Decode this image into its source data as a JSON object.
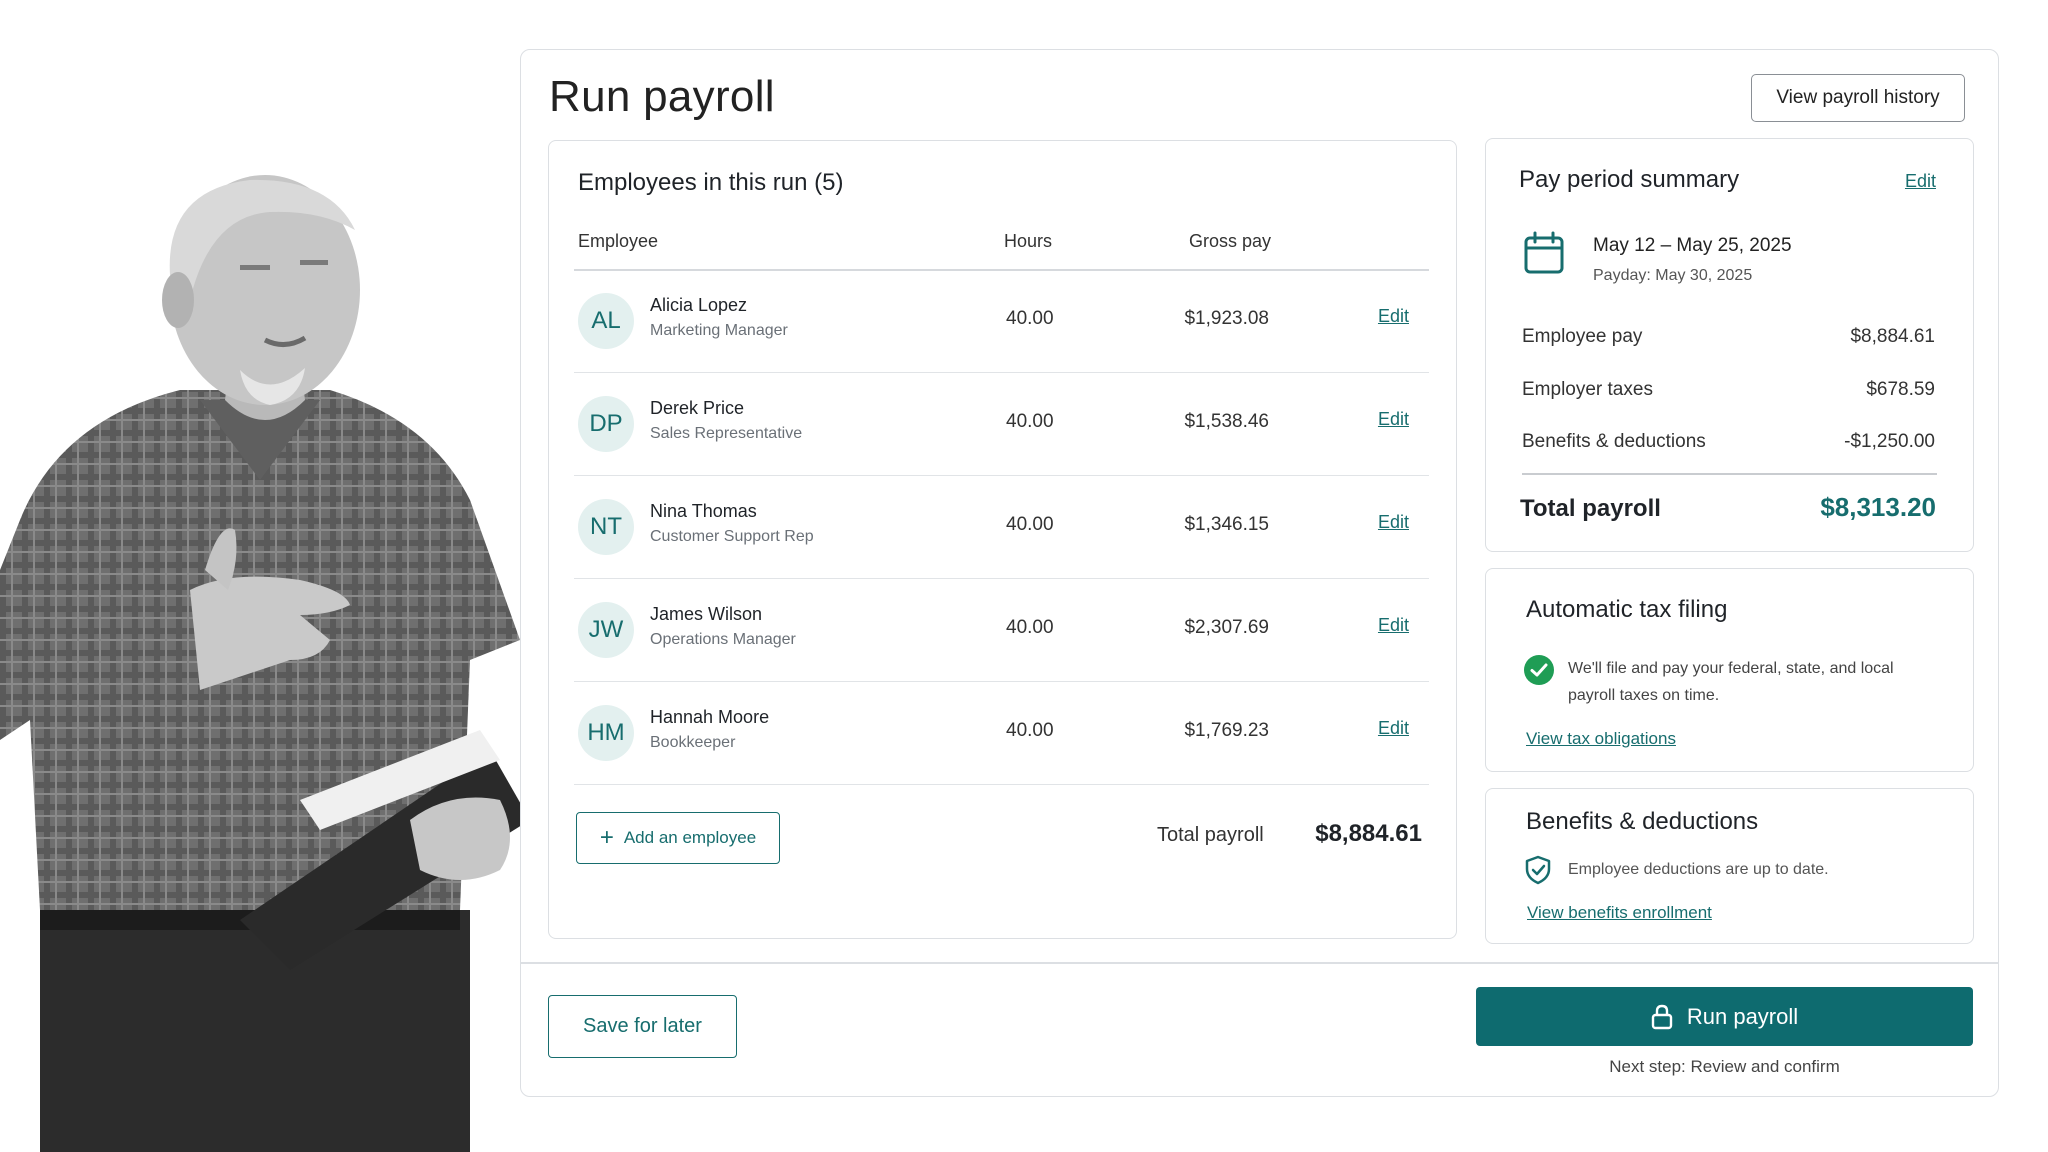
{
  "page": {
    "title": "Run payroll",
    "history_button": "View payroll history"
  },
  "employees_panel": {
    "title": "Employees in this run (5)",
    "columns": {
      "employee": "Employee",
      "hours": "Hours",
      "gross": "Gross pay"
    },
    "edit_label": "Edit",
    "rows": [
      {
        "initials": "AL",
        "name": "Alicia Lopez",
        "role": "Marketing Manager",
        "hours": "40.00",
        "gross": "$1,923.08"
      },
      {
        "initials": "DP",
        "name": "Derek Price",
        "role": "Sales Representative",
        "hours": "40.00",
        "gross": "$1,538.46"
      },
      {
        "initials": "NT",
        "name": "Nina Thomas",
        "role": "Customer Support Rep",
        "hours": "40.00",
        "gross": "$1,346.15"
      },
      {
        "initials": "JW",
        "name": "James Wilson",
        "role": "Operations Manager",
        "hours": "40.00",
        "gross": "$2,307.69"
      },
      {
        "initials": "HM",
        "name": "Hannah Moore",
        "role": "Bookkeeper",
        "hours": "40.00",
        "gross": "$1,769.23"
      }
    ],
    "add_button": "Add an employee",
    "total_label": "Total payroll",
    "total_value": "$8,884.61"
  },
  "summary": {
    "title": "Pay period summary",
    "edit_label": "Edit",
    "period_range": "May 12 – May 25, 2025",
    "payday": "Payday: May 30, 2025",
    "lines": [
      {
        "label": "Employee pay",
        "value": "$8,884.61"
      },
      {
        "label": "Employer taxes",
        "value": "$678.59"
      },
      {
        "label": "Benefits & deductions",
        "value": "-$1,250.00"
      }
    ],
    "total_label": "Total payroll",
    "total_value": "$8,313.20"
  },
  "tax_filing": {
    "title": "Automatic tax filing",
    "description": "We'll file and pay your federal, state, and local payroll taxes on time.",
    "link": "View tax obligations"
  },
  "benefits": {
    "title": "Benefits & deductions",
    "description": "Employee deductions are up to date.",
    "link": "View benefits enrollment"
  },
  "footer": {
    "save_button": "Save for later",
    "run_button": "Run payroll",
    "next_step": "Next step: Review and confirm"
  },
  "colors": {
    "accent": "#0e6b6f",
    "avatar_bg": "#e3f0ef",
    "success": "#1f9d55"
  }
}
